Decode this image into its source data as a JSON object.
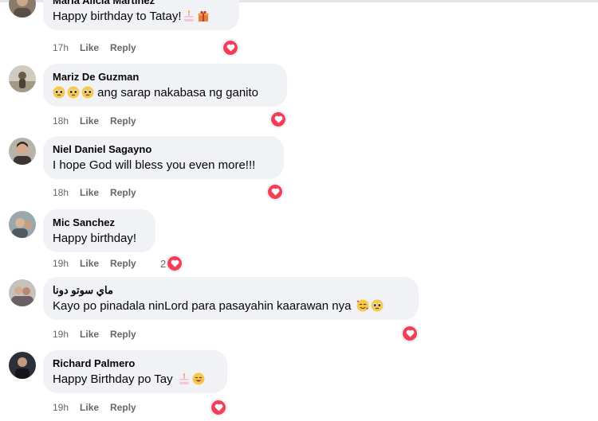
{
  "comments": [
    {
      "name": "Maria Alicia Martinez",
      "text": "Happy birthday to Tatay!",
      "emojis": [
        "cake",
        "gift"
      ],
      "time": "17h",
      "like": "Like",
      "reply": "Reply",
      "reaction_count": ""
    },
    {
      "name": "Mariz De Guzman",
      "text": "ang sarap nakabasa ng ganito",
      "emojis_before": [
        "pleading",
        "pleading",
        "pleading"
      ],
      "time": "18h",
      "like": "Like",
      "reply": "Reply",
      "reaction_count": ""
    },
    {
      "name": "Niel Daniel Sagayno",
      "text": "I hope God will bless you even more!!!",
      "time": "18h",
      "like": "Like",
      "reply": "Reply",
      "reaction_count": ""
    },
    {
      "name": "Mic Sanchez",
      "text": "Happy birthday!",
      "time": "19h",
      "like": "Like",
      "reply": "Reply",
      "reaction_count": "2"
    },
    {
      "name": "ماي سوتو دونا",
      "text": "Kayo po pinadala ninLord para pasayahin kaarawan nya",
      "emojis": [
        "smiling-hearts",
        "pleading"
      ],
      "time": "19h",
      "like": "Like",
      "reply": "Reply",
      "reaction_count": ""
    },
    {
      "name": "Richard Palmero",
      "text": "Happy Birthday po Tay",
      "emojis": [
        "cake",
        "smile"
      ],
      "time": "19h",
      "like": "Like",
      "reply": "Reply",
      "reaction_count": ""
    }
  ],
  "reaction_icon": "heart-icon",
  "colors": {
    "bubble": "#f0f2f5",
    "heart": "#f33e58",
    "meta": "#65676b",
    "text": "#050505"
  }
}
